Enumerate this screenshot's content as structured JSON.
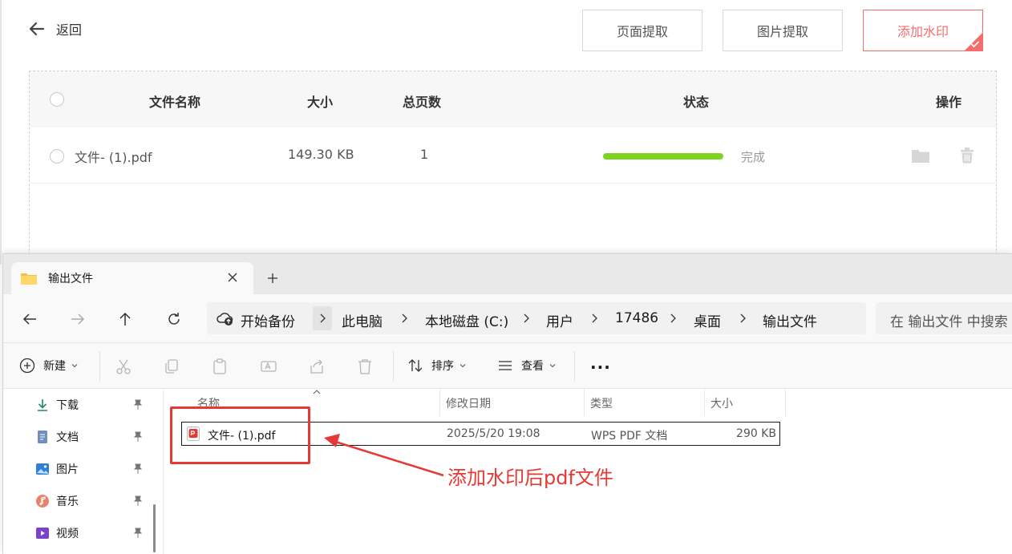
{
  "app": {
    "back_label": "返回",
    "tools": [
      "页面提取",
      "图片提取",
      "添加水印"
    ],
    "table": {
      "headers": {
        "name": "文件名称",
        "size": "大小",
        "pages": "总页数",
        "status": "状态",
        "ops": "操作"
      },
      "rows": [
        {
          "name": "文件- (1).pdf",
          "size": "149.30 KB",
          "pages": "1",
          "status": "完成",
          "progress": 1.0
        }
      ]
    },
    "accent_color": "#f56c6c",
    "progress_color": "#7ed321"
  },
  "explorer": {
    "tab_title": "输出文件",
    "breadcrumb": [
      "开始备份",
      "此电脑",
      "本地磁盘 (C:)",
      "用户",
      "17486",
      "桌面",
      "输出文件"
    ],
    "search_placeholder": "在 输出文件 中搜索",
    "toolbar": {
      "new_label": "新建",
      "sort_label": "排序",
      "view_label": "查看",
      "more_label": "..."
    },
    "nav_items": [
      {
        "label": "下载",
        "icon": "download-icon"
      },
      {
        "label": "文档",
        "icon": "document-icon"
      },
      {
        "label": "图片",
        "icon": "picture-icon"
      },
      {
        "label": "音乐",
        "icon": "music-icon"
      },
      {
        "label": "视频",
        "icon": "video-icon"
      }
    ],
    "columns": {
      "name": "名称",
      "modified": "修改日期",
      "type": "类型",
      "size": "大小"
    },
    "files": [
      {
        "name": "文件- (1).pdf",
        "modified": "2025/5/20 19:08",
        "type": "WPS PDF 文档",
        "size": "290 KB"
      }
    ]
  },
  "annotation": {
    "text": "添加水印后pdf文件",
    "color": "#e53935"
  }
}
